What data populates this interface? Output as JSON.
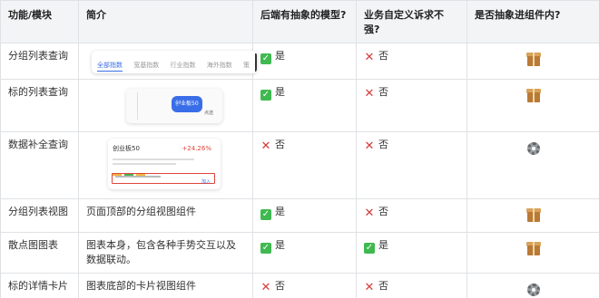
{
  "headers": [
    "功能/模块",
    "简介",
    "后端有抽象的模型?",
    "业务自定义诉求不强?",
    "是否抽象进组件内?"
  ],
  "rows": [
    {
      "name": "分组列表查询",
      "desc": "",
      "thumb": {
        "tabs": [
          "全部指数",
          "宽基指数",
          "行业指数",
          "海外指数",
          "策"
        ]
      },
      "backend_mark": "yes",
      "backend": "是",
      "business_mark": "no",
      "business": "否",
      "result_icon": "box-icon"
    },
    {
      "name": "标的列表查询",
      "desc": "",
      "thumb": {
        "pill": "创业板50",
        "btn": "点选"
      },
      "backend_mark": "yes",
      "backend": "是",
      "business_mark": "no",
      "business": "否",
      "result_icon": "box-icon"
    },
    {
      "name": "数据补全查询",
      "desc": "",
      "thumb": {
        "name": "创业板50",
        "pct": "+24.26%",
        "link": "加入"
      },
      "backend_mark": "no",
      "backend": "否",
      "business_mark": "no",
      "business": "否",
      "result_icon": "gear-icon"
    },
    {
      "name": "分组列表视图",
      "desc": "页面顶部的分组视图组件",
      "backend_mark": "yes",
      "backend": "是",
      "business_mark": "no",
      "business": "否",
      "result_icon": "box-icon"
    },
    {
      "name": "散点图图表",
      "desc": "图表本身，包含各种手势交互以及数据联动。",
      "backend_mark": "yes",
      "backend": "是",
      "business_mark": "yes",
      "business": "是",
      "result_icon": "box-icon"
    },
    {
      "name": "标的详情卡片",
      "desc": "图表底部的卡片视图组件",
      "backend_mark": "no",
      "backend": "否",
      "business_mark": "no",
      "business": "否",
      "result_icon": "gear-icon"
    }
  ],
  "marks": {
    "yes": "✓",
    "no": "✕"
  },
  "colors": {
    "yes": "#3fb950",
    "no": "#d73a3a",
    "header_bg": "#f3f4f6",
    "border": "#dfe2e5",
    "accent": "#3a6ee8"
  }
}
